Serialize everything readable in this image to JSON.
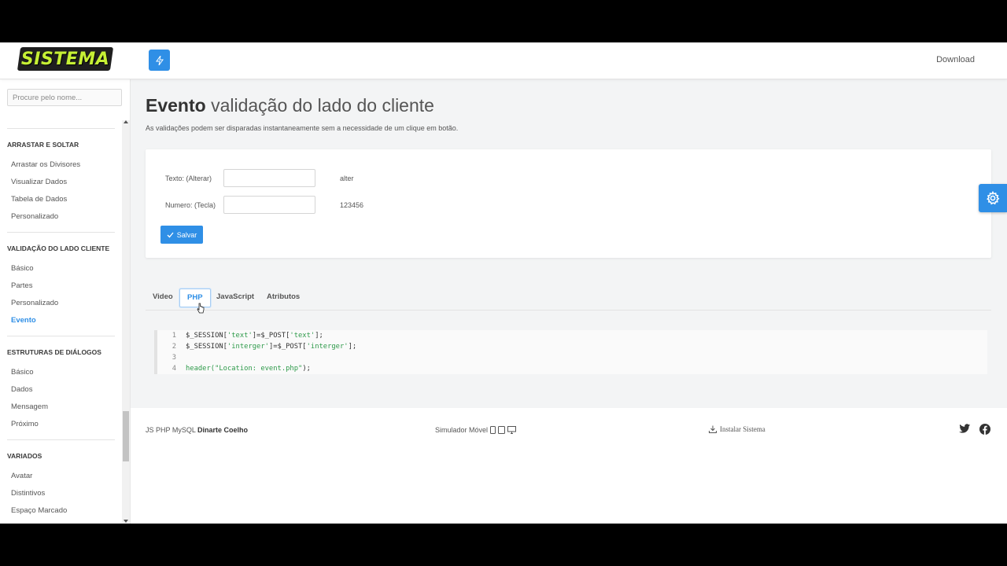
{
  "header": {
    "logo_text": "SISTEMA",
    "download_label": "Download"
  },
  "sidebar": {
    "search_placeholder": "Procure pelo nome...",
    "groups": [
      {
        "title": "ARRASTAR E SOLTAR",
        "items": [
          "Arrastar os Divisores",
          "Visualizar Dados",
          "Tabela de Dados",
          "Personalizado"
        ]
      },
      {
        "title": "VALIDAÇÃO DO LADO CLIENTE",
        "items": [
          "Básico",
          "Partes",
          "Personalizado",
          "Evento"
        ]
      },
      {
        "title": "ESTRUTURAS DE DIÁLOGOS",
        "items": [
          "Básico",
          "Dados",
          "Mensagem",
          "Próximo"
        ]
      },
      {
        "title": "VARIADOS",
        "items": [
          "Avatar",
          "Distintivos",
          "Espaço Marcado"
        ]
      }
    ],
    "active_item": "Evento"
  },
  "page": {
    "title_bold": "Evento",
    "title_rest": " validação do lado do cliente",
    "subtitle": "As validações podem ser disparadas instantaneamente sem a necessidade de um clique em botão."
  },
  "form": {
    "text_label": "Texto: (Alterar)",
    "text_value": "",
    "text_output": "alter",
    "number_label": "Numero: (Tecla)",
    "number_value": "",
    "number_output": "123456",
    "save_label": "Salvar"
  },
  "tabs": {
    "items": [
      "Video",
      "PHP",
      "JavaScript",
      "Atributos"
    ],
    "active": "PHP"
  },
  "code": {
    "lines": [
      {
        "n": "1",
        "parts": [
          [
            "$_SESSION[",
            ""
          ],
          [
            "'text'",
            "str"
          ],
          [
            "]=$_POST[",
            ""
          ],
          [
            "'text'",
            "str"
          ],
          [
            "];",
            ""
          ]
        ]
      },
      {
        "n": "2",
        "parts": [
          [
            "$_SESSION[",
            ""
          ],
          [
            "'interger'",
            "str"
          ],
          [
            "]=$_POST[",
            ""
          ],
          [
            "'interger'",
            "str"
          ],
          [
            "];",
            ""
          ]
        ]
      },
      {
        "n": "3",
        "parts": []
      },
      {
        "n": "4",
        "parts": [
          [
            "header(",
            "str"
          ],
          [
            "\"Location: event.php\"",
            "str"
          ],
          [
            ");",
            ""
          ]
        ]
      }
    ]
  },
  "footer": {
    "left_prefix": "JS PHP MySQL",
    "left_author": "Dinarte Coelho",
    "mobile_sim_label": "Simulador Móvel",
    "install_label": "Instalar  Sistema"
  },
  "colors": {
    "accent": "#2f8fe6",
    "logo_text": "#c6f035",
    "code_string": "#2e9a4a"
  }
}
